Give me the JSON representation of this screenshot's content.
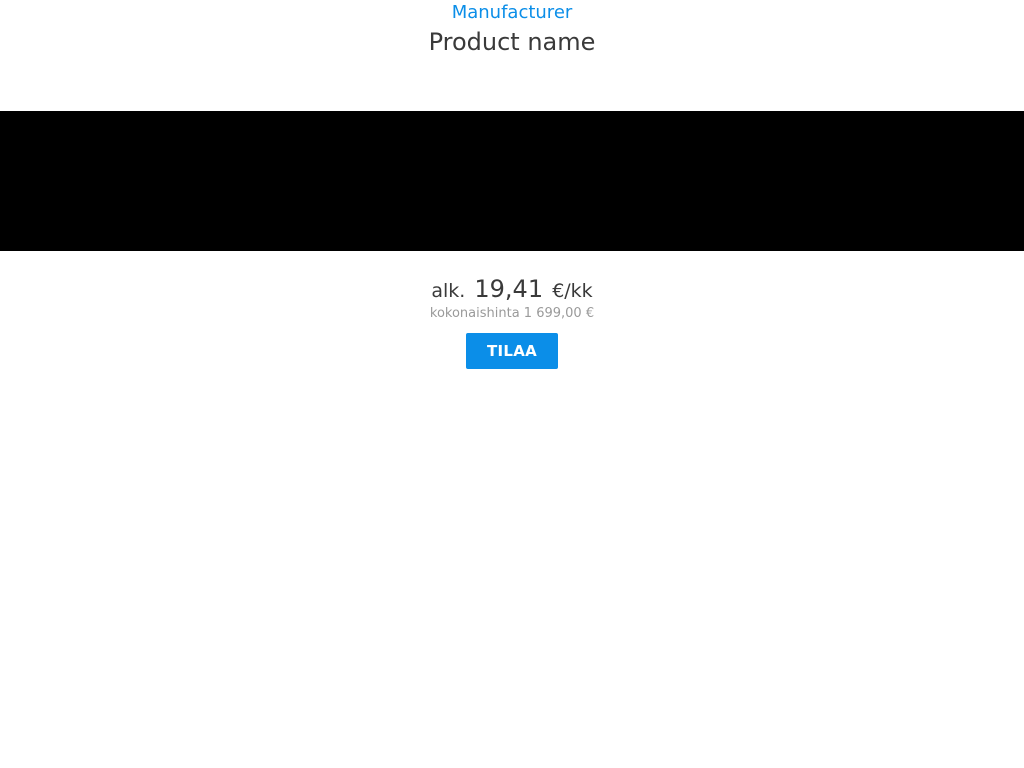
{
  "product": {
    "manufacturer": "Manufacturer",
    "name": "Product name"
  },
  "pricing": {
    "prefix": "alk.",
    "monthly_amount": "19,41",
    "unit": "€/kk",
    "total_label": "kokonaishinta 1 699,00 €"
  },
  "actions": {
    "order_label": "TILAA"
  },
  "colors": {
    "accent": "#0b8ee8",
    "text": "#3a3a3a",
    "muted": "#9a9a9a",
    "image_placeholder": "#000000"
  }
}
